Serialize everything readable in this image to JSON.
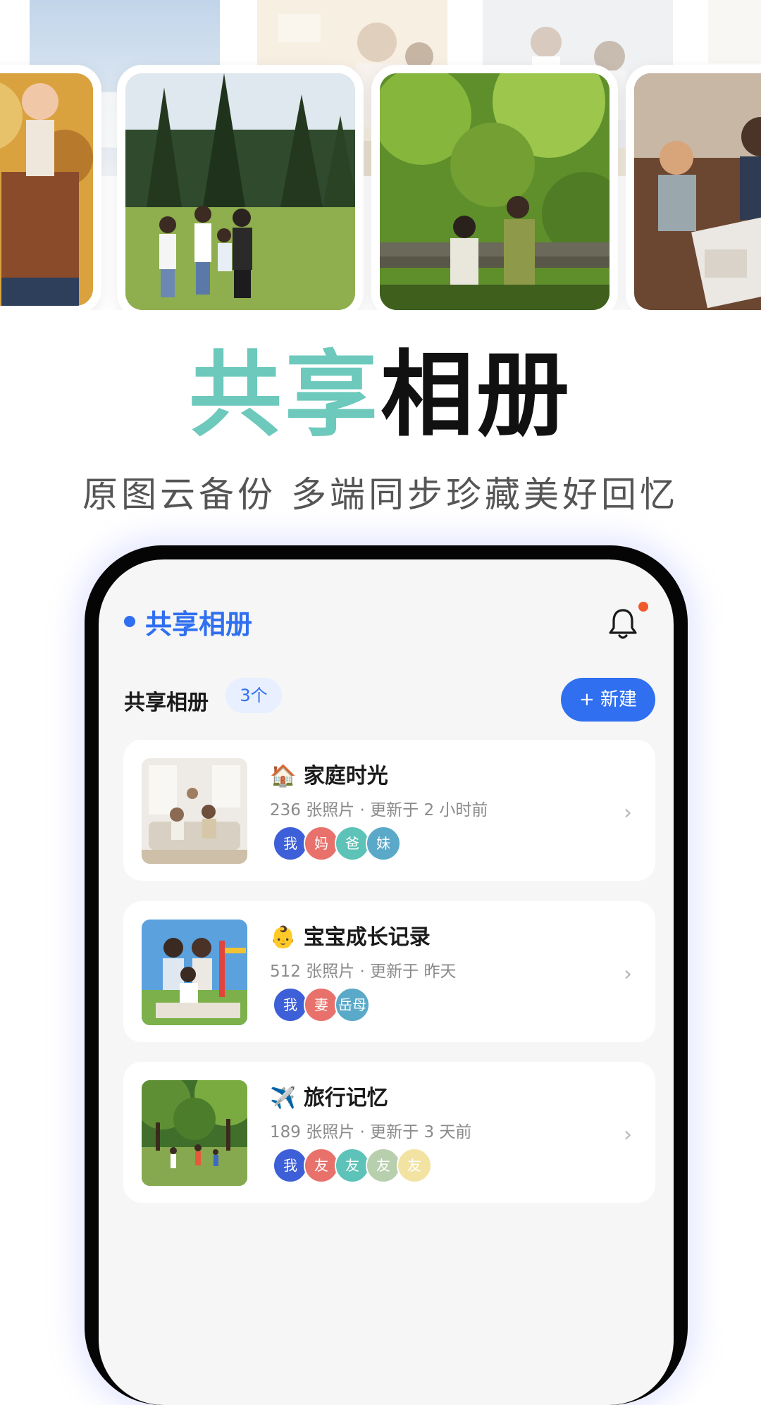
{
  "hero": {
    "title_accent": "共享",
    "title_rest": "相册",
    "subtitle": "原图云备份 多端同步珍藏美好回忆"
  },
  "app": {
    "title": "共享相册",
    "section_title": "共享相册",
    "count_badge": "3个",
    "new_button": "+ 新建",
    "albums": [
      {
        "icon": "🏠",
        "name": "家庭时光",
        "meta": "236 张照片 · 更新于 2 小时前",
        "members": [
          "我",
          "妈",
          "爸",
          "妹"
        ],
        "thumb_icon": "family-living-room-photo"
      },
      {
        "icon": "👶",
        "name": "宝宝成长记录",
        "meta": "512 张照片 · 更新于 昨天",
        "members": [
          "我",
          "妻",
          "岳母"
        ],
        "thumb_icon": "family-playground-photo"
      },
      {
        "icon": "✈️",
        "name": "旅行记忆",
        "meta": "189 张照片 · 更新于 3 天前",
        "members": [
          "我",
          "友",
          "友",
          "友",
          "友"
        ],
        "thumb_icon": "park-walk-photo"
      }
    ]
  },
  "colors": {
    "accent_teal": "#6cc9bc",
    "brand_blue": "#2f6ff0",
    "notification_dot": "#f05a2a",
    "avatar_colors": [
      "#3d5fd8",
      "#e8716b",
      "#5dc2b7",
      "#5aa9c9",
      "#b8cfae",
      "#f3e3a2"
    ]
  }
}
